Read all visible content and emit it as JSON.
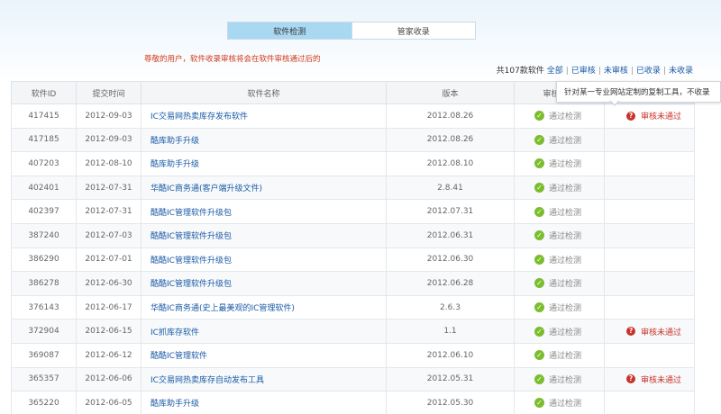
{
  "tabs": [
    {
      "label": "软件检测",
      "active": true
    },
    {
      "label": "管家收录",
      "active": false
    }
  ],
  "notice": "尊敬的用户，软件收录审核将会在软件审核通过后的",
  "filters": {
    "prefix": "共107款软件",
    "items": [
      "全部",
      "已审核",
      "未审核",
      "已收录",
      "未收录"
    ]
  },
  "table": {
    "headers": [
      "软件ID",
      "提交时间",
      "软件名称",
      "版本",
      "审核状态",
      ""
    ],
    "rows": [
      {
        "id": "417415",
        "date": "2012-09-03",
        "name": "IC交易网热卖库存发布软件",
        "version": "2012.08.26",
        "status": "通过检测",
        "review": "审核未通过"
      },
      {
        "id": "417185",
        "date": "2012-09-03",
        "name": "酷库助手升级",
        "version": "2012.08.26",
        "status": "通过检测",
        "review": ""
      },
      {
        "id": "407203",
        "date": "2012-08-10",
        "name": "酷库助手升级",
        "version": "2012.08.10",
        "status": "通过检测",
        "review": ""
      },
      {
        "id": "402401",
        "date": "2012-07-31",
        "name": "华酷IC商务通(客户端升级文件)",
        "version": "2.8.41",
        "status": "通过检测",
        "review": ""
      },
      {
        "id": "402397",
        "date": "2012-07-31",
        "name": "酷酷IC管理软件升级包",
        "version": "2012.07.31",
        "status": "通过检测",
        "review": ""
      },
      {
        "id": "387240",
        "date": "2012-07-03",
        "name": "酷酷IC管理软件升级包",
        "version": "2012.06.31",
        "status": "通过检测",
        "review": ""
      },
      {
        "id": "386290",
        "date": "2012-07-01",
        "name": "酷酷IC管理软件升级包",
        "version": "2012.06.30",
        "status": "通过检测",
        "review": ""
      },
      {
        "id": "386278",
        "date": "2012-06-30",
        "name": "酷酷IC管理软件升级包",
        "version": "2012.06.28",
        "status": "通过检测",
        "review": ""
      },
      {
        "id": "376143",
        "date": "2012-06-17",
        "name": "华酷IC商务通(史上最美观的IC管理软件)",
        "version": "2.6.3",
        "status": "通过检测",
        "review": ""
      },
      {
        "id": "372904",
        "date": "2012-06-15",
        "name": "IC抓库存软件",
        "version": "1.1",
        "status": "通过检测",
        "review": "审核未通过"
      },
      {
        "id": "369087",
        "date": "2012-06-12",
        "name": "酷酷IC管理软件",
        "version": "2012.06.10",
        "status": "通过检测",
        "review": ""
      },
      {
        "id": "365357",
        "date": "2012-06-06",
        "name": "IC交易网热卖库存自动发布工具",
        "version": "2012.05.31",
        "status": "通过检测",
        "review": "审核未通过"
      },
      {
        "id": "365220",
        "date": "2012-06-05",
        "name": "酷库助手升级",
        "version": "2012.05.30",
        "status": "通过检测",
        "review": ""
      }
    ]
  },
  "tooltip": "针对某一专业网站定制的复制工具，不收录",
  "colors": {
    "accent_tab": "#a9d8f2",
    "notice": "#d23b1c",
    "link": "#1a5aa6",
    "ok": "#7bbd2e",
    "fail": "#c8342a"
  },
  "icons": {
    "ok": "check-circle-icon",
    "fail": "question-circle-icon"
  }
}
